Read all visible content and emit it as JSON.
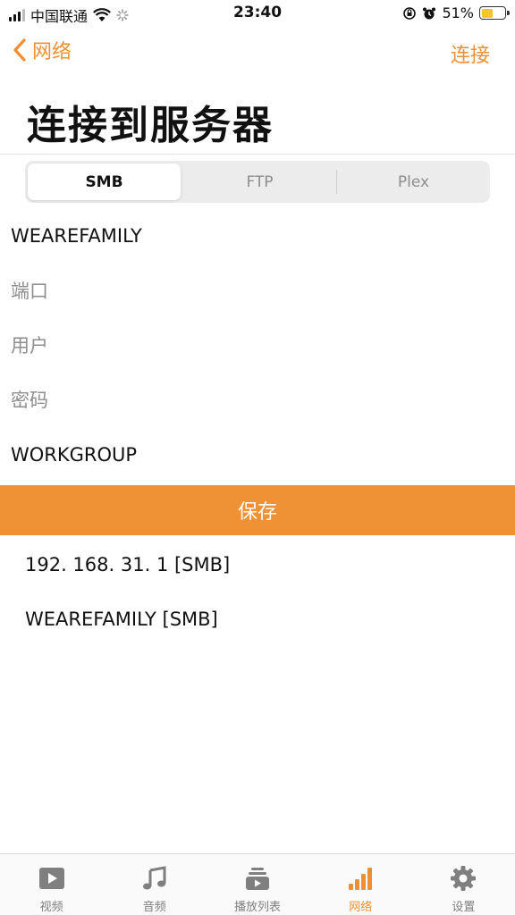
{
  "status_bar": {
    "carrier": "中国联通",
    "time": "23:40",
    "battery": "51%",
    "battery_level": 0.51
  },
  "nav": {
    "back_label": "网络",
    "action_label": "连接"
  },
  "title": "连接到服务器",
  "protocol_tabs": [
    {
      "label": "SMB",
      "active": true
    },
    {
      "label": "FTP",
      "active": false
    },
    {
      "label": "Plex",
      "active": false
    }
  ],
  "form": {
    "host": {
      "value": "WEAREFAMILY",
      "placeholder": ""
    },
    "port": {
      "value": "",
      "placeholder": "端口"
    },
    "user": {
      "value": "",
      "placeholder": "用户"
    },
    "password": {
      "value": "",
      "placeholder": "密码"
    },
    "workgroup": {
      "value": "WORKGROUP",
      "placeholder": ""
    }
  },
  "save_label": "保存",
  "saved_servers": [
    "192. 168. 31. 1 [SMB]",
    "WEAREFAMILY [SMB]"
  ],
  "tab_bar": [
    {
      "label": "视频",
      "icon": "video-icon",
      "active": false
    },
    {
      "label": "音频",
      "icon": "music-note-icon",
      "active": false
    },
    {
      "label": "播放列表",
      "icon": "playlist-icon",
      "active": false
    },
    {
      "label": "网络",
      "icon": "signal-bars-icon",
      "active": true
    },
    {
      "label": "设置",
      "icon": "gear-icon",
      "active": false
    }
  ],
  "colors": {
    "accent": "#ef8f33",
    "save_button": "#ef9236",
    "inactive": "#7f7f7f"
  }
}
